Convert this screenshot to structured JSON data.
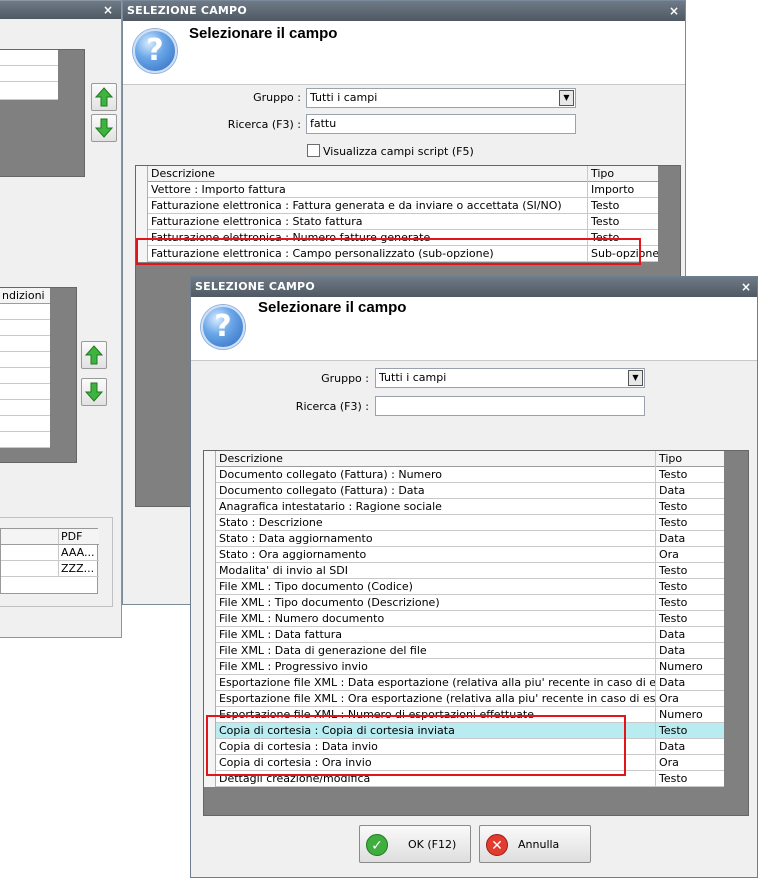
{
  "bg_window": {
    "close_glyph": "×",
    "table2_header": "ndizioni",
    "table3_header": "PDF",
    "table3_rows": [
      "AAA...",
      "ZZZ..."
    ]
  },
  "dialog1": {
    "title": "SELEZIONE CAMPO",
    "close_glyph": "×",
    "heading": "Selezionare il campo",
    "gruppo_label": "Gruppo :",
    "gruppo_value": "Tutti i campi",
    "ricerca_label": "Ricerca (F3) :",
    "ricerca_value": "fattu",
    "checkbox_label": "Visualizza campi script (F5)",
    "columns": [
      "Descrizione",
      "Tipo"
    ],
    "rows": [
      {
        "descrizione": "Vettore : Importo fattura",
        "tipo": "Importo"
      },
      {
        "descrizione": "Fatturazione elettronica : Fattura generata e da inviare o accettata (SI/NO)",
        "tipo": "Testo"
      },
      {
        "descrizione": "Fatturazione elettronica : Stato fattura",
        "tipo": "Testo"
      },
      {
        "descrizione": "Fatturazione elettronica : Numero fatture generate",
        "tipo": "Testo"
      },
      {
        "descrizione": "Fatturazione elettronica : Campo personalizzato (sub-opzione)",
        "tipo": "Sub-opzione"
      }
    ]
  },
  "dialog2": {
    "title": "SELEZIONE CAMPO",
    "close_glyph": "×",
    "heading": "Selezionare il campo",
    "gruppo_label": "Gruppo :",
    "gruppo_value": "Tutti i campi",
    "ricerca_label": "Ricerca (F3) :",
    "ricerca_value": "",
    "columns": [
      "Descrizione",
      "Tipo"
    ],
    "rows": [
      {
        "descrizione": "Documento collegato (Fattura) : Numero",
        "tipo": "Testo"
      },
      {
        "descrizione": "Documento collegato (Fattura) : Data",
        "tipo": "Data"
      },
      {
        "descrizione": "Anagrafica intestatario : Ragione sociale",
        "tipo": "Testo"
      },
      {
        "descrizione": "Stato : Descrizione",
        "tipo": "Testo"
      },
      {
        "descrizione": "Stato : Data aggiornamento",
        "tipo": "Data"
      },
      {
        "descrizione": "Stato : Ora aggiornamento",
        "tipo": "Ora"
      },
      {
        "descrizione": "Modalita' di invio al SDI",
        "tipo": "Testo"
      },
      {
        "descrizione": "File XML : Tipo documento (Codice)",
        "tipo": "Testo"
      },
      {
        "descrizione": "File XML : Tipo documento (Descrizione)",
        "tipo": "Testo"
      },
      {
        "descrizione": "File XML : Numero documento",
        "tipo": "Testo"
      },
      {
        "descrizione": "File XML : Data fattura",
        "tipo": "Data"
      },
      {
        "descrizione": "File XML : Data di generazione del file",
        "tipo": "Data"
      },
      {
        "descrizione": "File XML : Progressivo invio",
        "tipo": "Numero"
      },
      {
        "descrizione": "Esportazione file XML : Data esportazione (relativa alla piu' recente in caso di esportazio...",
        "tipo": "Data"
      },
      {
        "descrizione": "Esportazione file XML : Ora esportazione (relativa alla piu' recente in caso di esportazion...",
        "tipo": "Ora"
      },
      {
        "descrizione": "Esportazione file XML : Numero di esportazioni effettuate",
        "tipo": "Numero"
      },
      {
        "descrizione": "Copia di cortesia : Copia di cortesia inviata",
        "tipo": "Testo"
      },
      {
        "descrizione": "Copia di cortesia : Data invio",
        "tipo": "Data"
      },
      {
        "descrizione": "Copia di cortesia : Ora invio",
        "tipo": "Ora"
      },
      {
        "descrizione": "Dettagli creazione/modifica",
        "tipo": "Testo"
      }
    ],
    "selected_row": 16,
    "ok_label": "OK (F12)",
    "cancel_label": "Annulla (ESC)"
  },
  "colors": {
    "title_bar": "#5a6570",
    "selected_row": "#b9ecf0",
    "highlight_box": "#e0161b",
    "grid_background": "#808080"
  }
}
